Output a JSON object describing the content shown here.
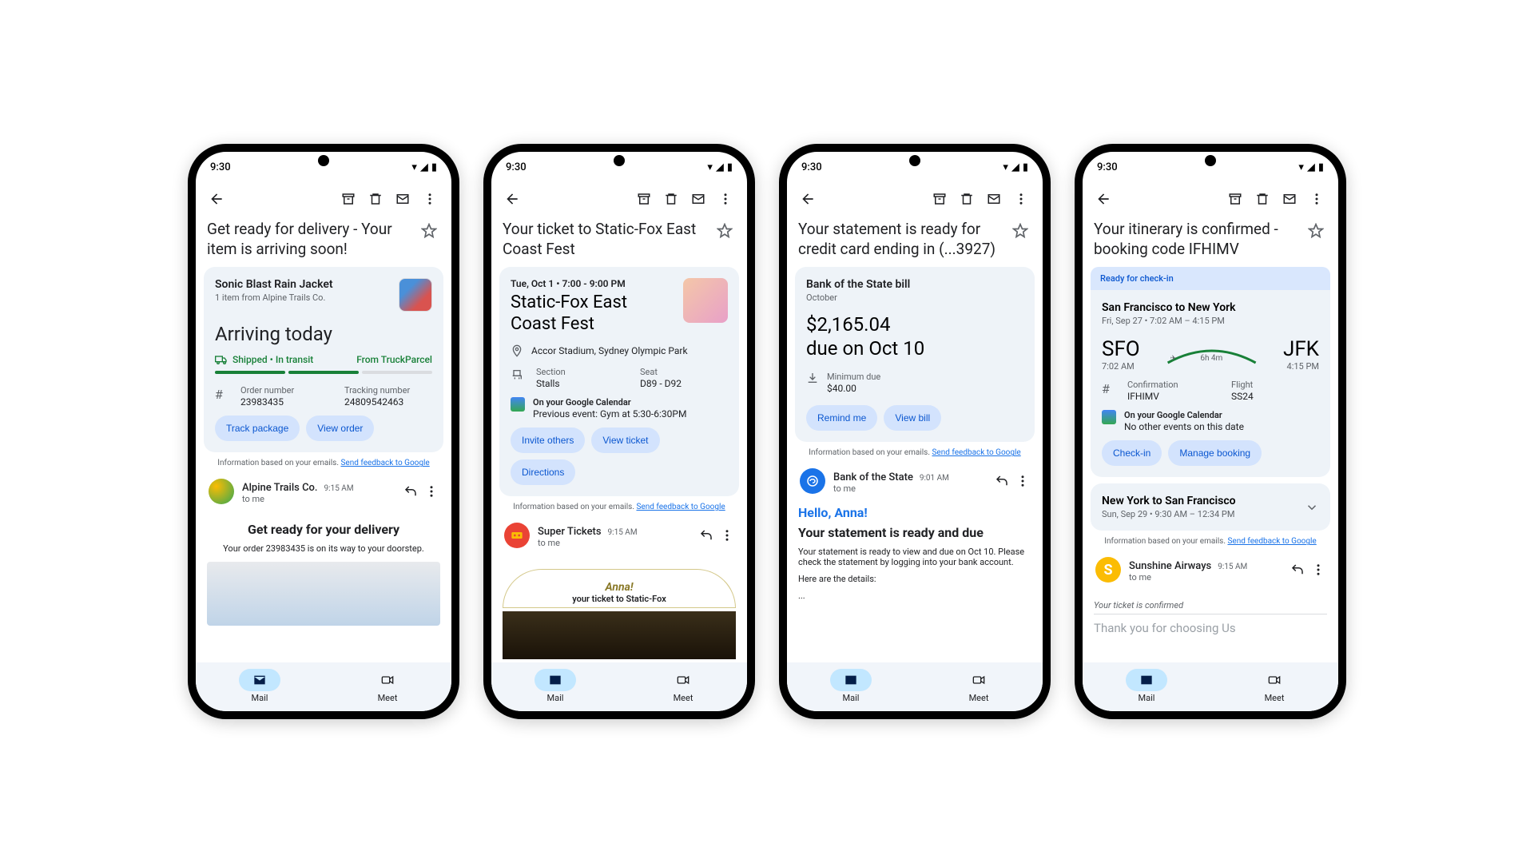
{
  "status": {
    "time": "9:30"
  },
  "nav": {
    "mail": "Mail",
    "meet": "Meet"
  },
  "feedback": {
    "prefix": "Information based on your emails.",
    "link": "Send feedback to Google"
  },
  "phones": [
    {
      "subject": "Get ready for delivery - Your item is arriving soon!",
      "delivery": {
        "product": "Sonic Blast Rain Jacket",
        "sub": "1 item from Alpine Trails Co.",
        "status": "Arriving today",
        "ship_status": "Shipped • In transit",
        "carrier": "From TruckParcel",
        "order_label": "Order number",
        "order_value": "23983435",
        "tracking_label": "Tracking number",
        "tracking_value": "24809542463",
        "btn_track": "Track package",
        "btn_view": "View order"
      },
      "sender": {
        "name": "Alpine Trails Co.",
        "time": "9:15 AM",
        "to": "to me"
      },
      "body": {
        "title": "Get ready for your delivery",
        "line": "Your order 23983435 is on its way to your doorstep."
      }
    },
    {
      "subject": "Your ticket to Static-Fox East Coast Fest",
      "event": {
        "date": "Tue, Oct 1 • 7:00 - 9:00 PM",
        "title": "Static-Fox East Coast Fest",
        "location": "Accor Stadium, Sydney Olympic Park",
        "section_label": "Section",
        "section_value": "Stalls",
        "seat_label": "Seat",
        "seat_value": "D89 - D92",
        "cal_label": "On your Google Calendar",
        "cal_value": "Previous event: Gym at 5:30-6:30PM",
        "btn_invite": "Invite others",
        "btn_view": "View ticket",
        "btn_dir": "Directions"
      },
      "sender": {
        "name": "Super Tickets",
        "time": "9:15 AM",
        "to": "to me"
      },
      "body": {
        "name": "Anna!",
        "line": "your ticket to Static-Fox"
      }
    },
    {
      "subject": "Your statement is ready for credit card ending in (...3927)",
      "bill": {
        "title": "Bank of the State bill",
        "month": "October",
        "amount": "$2,165.04",
        "due": "due on Oct 10",
        "min_label": "Minimum due",
        "min_value": "$40.00",
        "btn_remind": "Remind me",
        "btn_view": "View bill"
      },
      "sender": {
        "name": "Bank of the State",
        "time": "9:01 AM",
        "to": "to me"
      },
      "body": {
        "greet": "Hello, Anna!",
        "title": "Your statement is ready and due",
        "p1": "Your statement is ready to view and due on Oct 10. Please check the statement by logging into your bank account.",
        "p2": "Here are the details:",
        "p3": "..."
      }
    },
    {
      "subject": "Your itinerary is confirmed - booking code IFHIMV",
      "banner": "Ready for check-in",
      "flight": {
        "route": "San Francisco to New York",
        "sub": "Fri, Sep 27 • 7:02 AM – 4:15 PM",
        "from_code": "SFO",
        "from_time": "7:02 AM",
        "to_code": "JFK",
        "to_time": "4:15 PM",
        "duration": "6h 4m",
        "conf_label": "Confirmation",
        "conf_value": "IFHIMV",
        "flight_label": "Flight",
        "flight_value": "SS24",
        "cal_label": "On your Google Calendar",
        "cal_value": "No other events on this date",
        "btn_checkin": "Check-in",
        "btn_manage": "Manage booking"
      },
      "return": {
        "route": "New York to San Francisco",
        "sub": "Sun, Sep 29 • 9:30 AM – 12:34 PM"
      },
      "sender": {
        "name": "Sunshine Airways",
        "time": "9:15 AM",
        "to": "to me"
      },
      "body": {
        "line1": "Your ticket is confirmed",
        "line2": "Thank you for choosing Us"
      }
    }
  ]
}
